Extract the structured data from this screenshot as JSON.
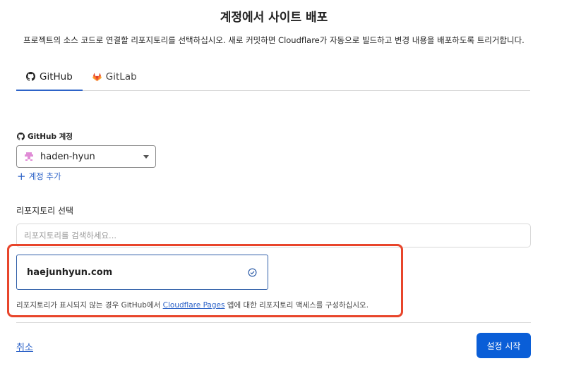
{
  "header": {
    "title": "계정에서 사이트 배포",
    "subtitle": "프로젝트의 소스 코드로 연결할 리포지토리를 선택하십시오. 새로 커밋하면 Cloudflare가 자동으로 빌드하고 변경 내용을 배포하도록 트리거합니다."
  },
  "tabs": [
    {
      "label": "GitHub",
      "icon": "github-icon",
      "active": true
    },
    {
      "label": "GitLab",
      "icon": "gitlab-icon",
      "active": false
    }
  ],
  "account": {
    "label": "GitHub 계정",
    "selected": "haden-hyun",
    "add_label": "계정 추가"
  },
  "repository": {
    "label": "리포지토리 선택",
    "search_placeholder": "리포지토리를 검색하세요...",
    "items": [
      {
        "name": "haejunhyun.com",
        "selected": true
      }
    ],
    "hint_prefix": "리포지토리가 표시되지 않는 경우 GitHub에서 ",
    "hint_link": "Cloudflare Pages",
    "hint_suffix": " 앱에 대한 리포지토리 액세스를 구성하십시오."
  },
  "footer": {
    "cancel_label": "취소",
    "start_label": "설정 시작"
  },
  "colors": {
    "accent": "#0a5ed7",
    "link": "#2d63c8",
    "highlight": "#e8452b"
  }
}
